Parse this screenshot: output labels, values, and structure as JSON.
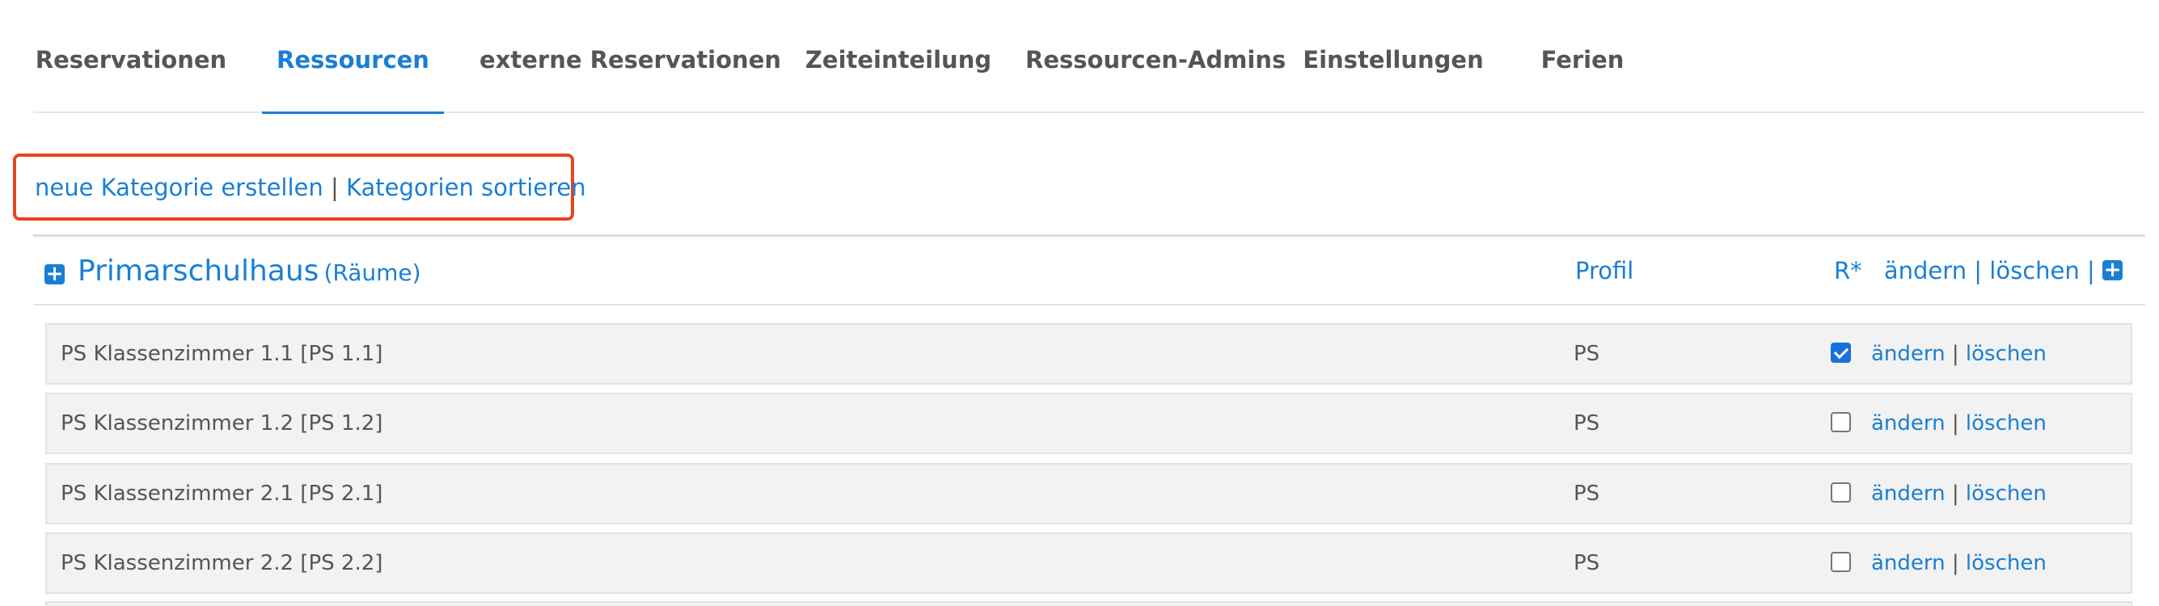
{
  "tabs": [
    {
      "label": "Reservationen",
      "active": false
    },
    {
      "label": "Ressourcen",
      "active": true
    },
    {
      "label": "externe Reservationen",
      "active": false
    },
    {
      "label": "Zeiteinteilung",
      "active": false
    },
    {
      "label": "Ressourcen-Admins",
      "active": false
    },
    {
      "label": "Einstellungen",
      "active": false
    },
    {
      "label": "Ferien",
      "active": false
    }
  ],
  "actions": {
    "create_category": "neue Kategorie erstellen",
    "separator": "|",
    "sort_categories": "Kategorien sortieren"
  },
  "category": {
    "expand_icon": "plus-square-icon",
    "name": "Primarschulhaus",
    "type": "(Räume)",
    "col_profil": "Profil",
    "col_r": "R*",
    "edit_label": "ändern",
    "delete_label": "löschen",
    "add_icon": "plus-square-icon"
  },
  "rows": [
    {
      "name": "PS Klassenzimmer 1.1 [PS 1.1]",
      "profil": "PS",
      "reservable": true,
      "edit": "ändern",
      "delete": "löschen"
    },
    {
      "name": "PS Klassenzimmer 1.2 [PS 1.2]",
      "profil": "PS",
      "reservable": false,
      "edit": "ändern",
      "delete": "löschen"
    },
    {
      "name": "PS Klassenzimmer 2.1 [PS 2.1]",
      "profil": "PS",
      "reservable": false,
      "edit": "ändern",
      "delete": "löschen"
    },
    {
      "name": "PS Klassenzimmer 2.2 [PS 2.2]",
      "profil": "PS",
      "reservable": false,
      "edit": "ändern",
      "delete": "löschen"
    }
  ],
  "colors": {
    "link": "#1a7fd4",
    "text": "#555555",
    "highlight_border": "#e8451f",
    "row_background": "#f2f2f2",
    "checkbox_checked": "#1a6fe0"
  }
}
